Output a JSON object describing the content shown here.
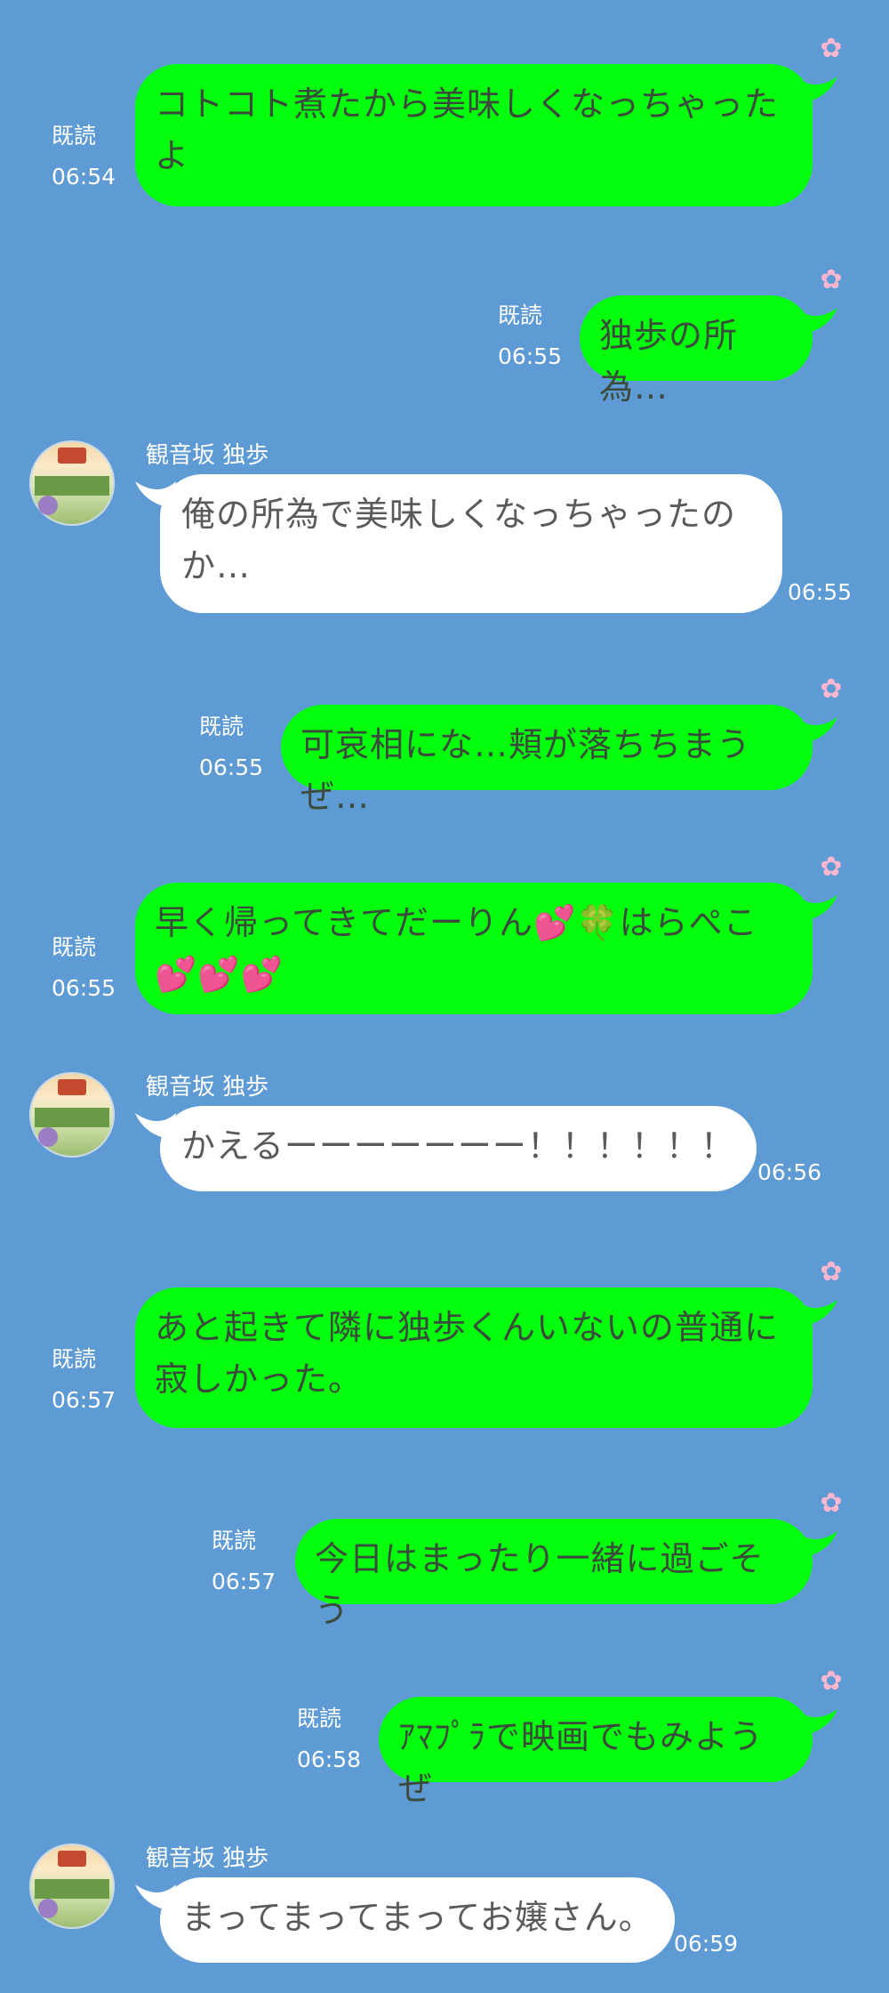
{
  "messages": [
    {
      "type": "out",
      "text": "コトコト煮たから美味しくなっちゃったよ",
      "read": "既読",
      "time": "06:54"
    },
    {
      "type": "out",
      "text": "独歩の所為…",
      "read": "既読",
      "time": "06:55"
    },
    {
      "type": "in",
      "sender": "観音坂 独歩",
      "text": "俺の所為で美味しくなっちゃったのか…",
      "time": "06:55"
    },
    {
      "type": "out",
      "text": "可哀相にな…頬が落ちちまうぜ…",
      "read": "既読",
      "time": "06:55"
    },
    {
      "type": "out",
      "text_a": "早く帰ってきてだーりん",
      "emoji_a": "💕",
      "emoji_b": "🍀",
      "text_b": "はらぺこ",
      "emoji_c": "💕💕💕",
      "read": "既読",
      "time": "06:55"
    },
    {
      "type": "in",
      "sender": "観音坂 独歩",
      "text": "かえるーーーーーーー！！！！！！",
      "time": "06:56"
    },
    {
      "type": "out",
      "text": "あと起きて隣に独歩くんいないの普通に寂しかった。",
      "read": "既読",
      "time": "06:57"
    },
    {
      "type": "out",
      "text": "今日はまったり一緒に過ごそう",
      "read": "既読",
      "time": "06:57"
    },
    {
      "type": "out",
      "text": "ｱﾏﾌﾟﾗで映画でもみようぜ",
      "read": "既読",
      "time": "06:58"
    },
    {
      "type": "in",
      "sender": "観音坂 独歩",
      "text": "まってまってまってお嬢さん。",
      "time": "06:59"
    }
  ],
  "icons": {
    "reaction": "sakura-flower-icon",
    "avatar": "jasmine-tea-bottle-avatar"
  },
  "colors": {
    "background": "#5e9bd4",
    "outgoing": "#03ff0c",
    "incoming": "#ffffff",
    "reaction": "#ffb6cf"
  }
}
